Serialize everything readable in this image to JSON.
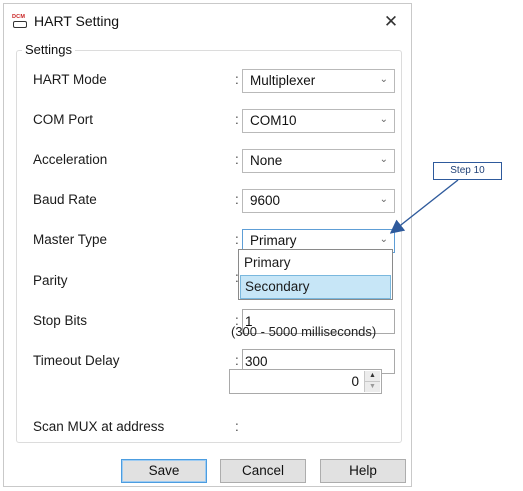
{
  "window": {
    "title": "HART Setting",
    "app_icon": {
      "name": "dcm-app-icon",
      "label": "DCM"
    },
    "close_icon": "close-icon"
  },
  "settings": {
    "legend": "Settings",
    "rows": {
      "hart_mode": {
        "label": "HART Mode",
        "value": "Multiplexer"
      },
      "com_port": {
        "label": "COM Port",
        "value": "COM10"
      },
      "acceleration": {
        "label": "Acceleration",
        "value": "None"
      },
      "baud_rate": {
        "label": "Baud Rate",
        "value": "9600"
      },
      "master_type": {
        "label": "Master Type",
        "value": "Primary"
      },
      "parity": {
        "label": "Parity"
      },
      "stop_bits": {
        "label": "Stop Bits",
        "value": "1"
      },
      "timeout_delay": {
        "label": "Timeout Delay",
        "value": "300",
        "hint": "(300 - 5000 milliseconds)"
      },
      "scan_mux": {
        "label": "Scan MUX at address",
        "value": "0"
      }
    },
    "colon": ":",
    "master_type_dropdown": {
      "options": [
        "Primary",
        "Secondary"
      ],
      "highlighted": "Secondary"
    }
  },
  "buttons": {
    "save": "Save",
    "cancel": "Cancel",
    "help": "Help"
  },
  "annotation": {
    "step_label": "Step 10",
    "color": "#2e5a9c"
  },
  "icons": {
    "chevron": "chevron-down-icon",
    "spin_up": "spin-up-icon",
    "spin_down": "spin-down-icon"
  }
}
